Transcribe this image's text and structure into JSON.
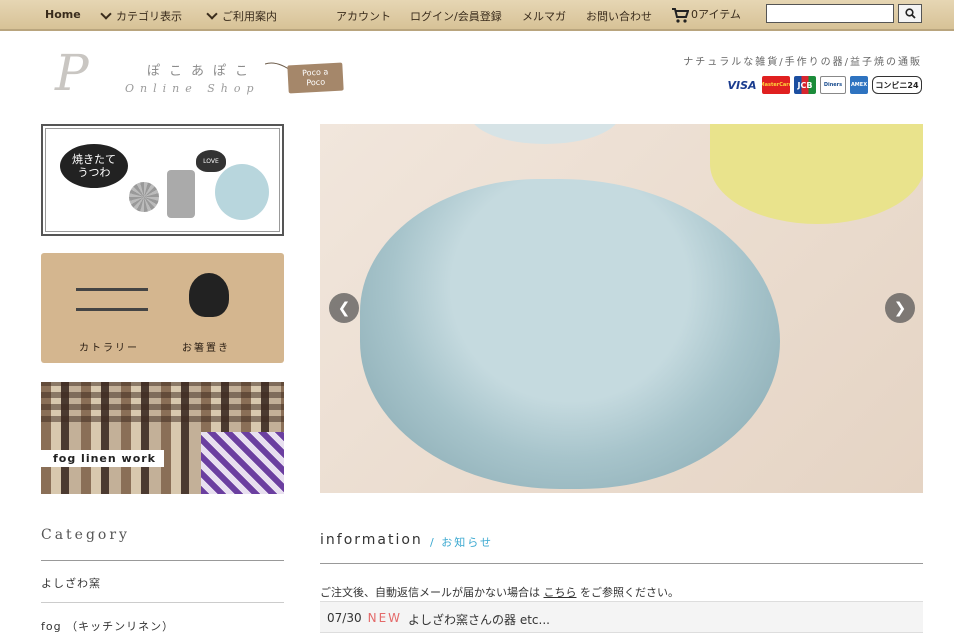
{
  "nav": {
    "home": "Home",
    "category": "カテゴリ表示",
    "guide": "ご利用案内",
    "account": "アカウント",
    "login": "ログイン/会員登録",
    "mailmag": "メルマガ",
    "contact": "お問い合わせ",
    "cart": "0アイテム",
    "search_icon": "search-icon"
  },
  "logo": {
    "letter": "P",
    "jp": "ぽこあぽこ",
    "en": "Online Shop",
    "tag": [
      "Poco a",
      "Poco"
    ]
  },
  "header": {
    "tagline": "ナチュラルな雑貨/手作りの器/益子焼の通販",
    "payments": [
      "VISA",
      "MasterCard",
      "JCB",
      "Diners",
      "AMEX",
      "コンビニ24"
    ]
  },
  "banners": {
    "b1_bubble": "焼きたてうつわ",
    "b1_heart": "LOVE",
    "b2_left": "カトラリー",
    "b2_right": "お箸置き",
    "b3_label": "fog linen work"
  },
  "slider": {
    "prev": "❮",
    "next": "❯"
  },
  "category": {
    "title": "Category",
    "items": [
      "よしざわ窯",
      "fog （キッチンリネン）"
    ]
  },
  "information": {
    "title": "information",
    "subtitle": "/ お知らせ",
    "notice_before": "ご注文後、自動返信メールが届かない場合は",
    "notice_link": "こちら",
    "notice_after": "をご参照ください。",
    "news": [
      {
        "date": "07/30",
        "badge": "NEW",
        "text": "よしざわ窯さんの器 etc..."
      }
    ]
  }
}
